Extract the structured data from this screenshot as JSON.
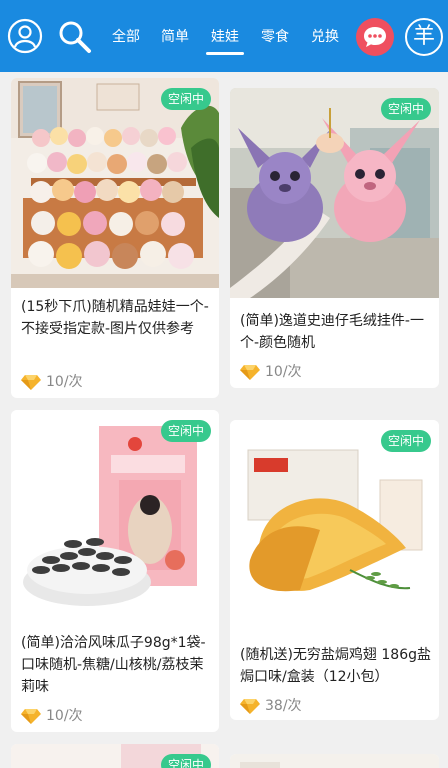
{
  "header": {
    "tabs": [
      {
        "label": "全部"
      },
      {
        "label": "简单"
      },
      {
        "label": "娃娃"
      },
      {
        "label": "零食"
      },
      {
        "label": "兑换"
      }
    ],
    "active_tab": "娃娃",
    "coin_symbol": "羊",
    "accent_color": "#1a8ae0",
    "badge_color": "#37c98d",
    "icons": [
      "user-icon",
      "search-icon",
      "chat-icon",
      "coin-icon"
    ]
  },
  "products": [
    {
      "title": "(15秒下爪)随机精品娃娃一个-不接受指定款-图片仅供参考",
      "price": "10/次",
      "status": "空闲中"
    },
    {
      "title": "(简单)逸道史迪仔毛绒挂件-一个-颜色随机",
      "price": "10/次",
      "status": "空闲中"
    },
    {
      "title": "(简单)洽洽风味瓜子98g*1袋-口味随机-焦糖/山核桃/荔枝茉莉味",
      "price": "10/次",
      "status": "空闲中"
    },
    {
      "title": "(随机送)无穷盐焗鸡翅 186g盐焗口味/盒装（12小包）",
      "price": "38/次",
      "status": "空闲中"
    },
    {
      "status": "空闲中"
    }
  ]
}
